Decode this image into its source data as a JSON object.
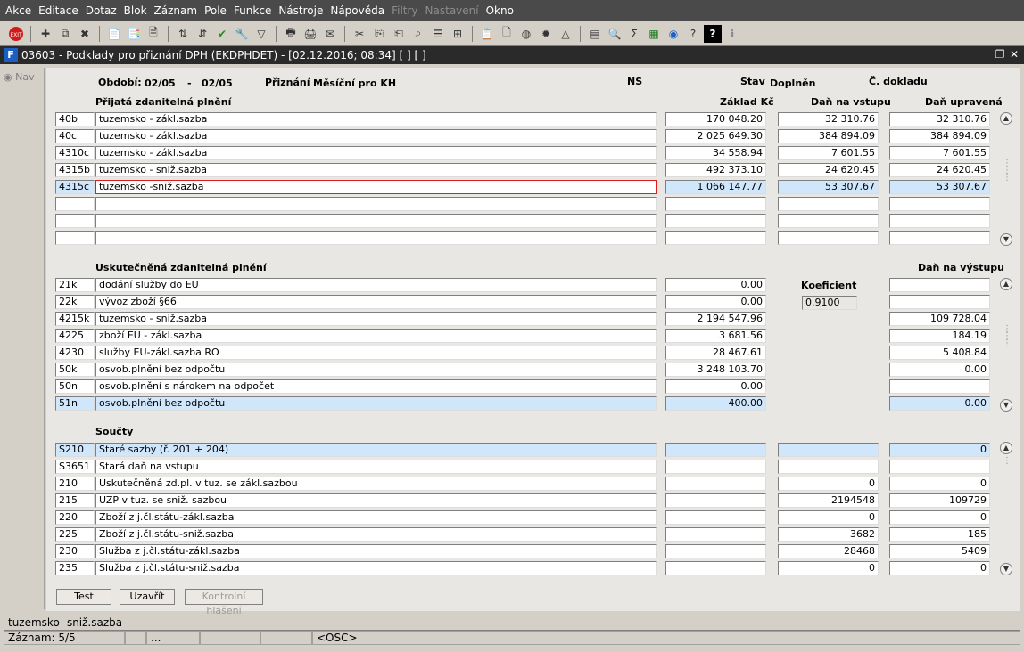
{
  "menu": [
    "Akce",
    "Editace",
    "Dotaz",
    "Blok",
    "Záznam",
    "Pole",
    "Funkce",
    "Nástroje",
    "Nápověda",
    "Filtry",
    "Nastavení",
    "Okno"
  ],
  "menu_disabled": [
    "Filtry",
    "Nastavení"
  ],
  "window_title": "03603 - Podklady pro přiznání DPH (EKDPHDET) - [02.12.2016; 08:34]  [ ]  [ ]",
  "nav_label": "Nav",
  "header": {
    "obdobi_label": "Období:",
    "obdobi_from": "02/05",
    "dash": "-",
    "obdobi_to": "02/05",
    "priznani_label": "Přiznání",
    "priznani_value": "Měsíční pro KH",
    "ns_label": "NS",
    "stav_label": "Stav",
    "stav_value": "Doplněn",
    "cdokladu_label": "Č. dokladu"
  },
  "section1": {
    "title": "Přijatá zdanitelná plnění",
    "col_zaklad": "Základ Kč",
    "col_dan_vstup": "Daň na vstupu",
    "col_dan_upr": "Daň upravená",
    "rows": [
      {
        "code": "40b",
        "desc": "tuzemsko - zákl.sazba",
        "zaklad": "170 048.20",
        "dan": "32 310.76",
        "upr": "32 310.76"
      },
      {
        "code": "40c",
        "desc": "tuzemsko - zákl.sazba",
        "zaklad": "2 025 649.30",
        "dan": "384 894.09",
        "upr": "384 894.09"
      },
      {
        "code": "4310c",
        "desc": "tuzemsko - zákl.sazba",
        "zaklad": "34 558.94",
        "dan": "7 601.55",
        "upr": "7 601.55"
      },
      {
        "code": "4315b",
        "desc": "tuzemsko - sniž.sazba",
        "zaklad": "492 373.10",
        "dan": "24 620.45",
        "upr": "24 620.45"
      },
      {
        "code": "4315c",
        "desc": "tuzemsko -sniž.sazba",
        "zaklad": "1 066 147.77",
        "dan": "53 307.67",
        "upr": "53 307.67"
      },
      {
        "code": "",
        "desc": "",
        "zaklad": "",
        "dan": "",
        "upr": ""
      },
      {
        "code": "",
        "desc": "",
        "zaklad": "",
        "dan": "",
        "upr": ""
      },
      {
        "code": "",
        "desc": "",
        "zaklad": "",
        "dan": "",
        "upr": ""
      }
    ]
  },
  "section2": {
    "title": "Uskutečněná zdanitelná plnění",
    "col_dan_vystup": "Daň na výstupu",
    "koef_label": "Koeficient",
    "koef_value": "0.9100",
    "rows": [
      {
        "code": "21k",
        "desc": "dodání služby do EU",
        "zaklad": "0.00",
        "dan": ""
      },
      {
        "code": "22k",
        "desc": "vývoz zboží §66",
        "zaklad": "0.00",
        "dan": ""
      },
      {
        "code": "4215k",
        "desc": "tuzemsko - sniž.sazba",
        "zaklad": "2 194 547.96",
        "dan": "109 728.04"
      },
      {
        "code": "4225",
        "desc": "zboží EU - zákl.sazba",
        "zaklad": "3 681.56",
        "dan": "184.19"
      },
      {
        "code": "4230",
        "desc": "služby EU-zákl.sazba RO",
        "zaklad": "28 467.61",
        "dan": "5 408.84"
      },
      {
        "code": "50k",
        "desc": "osvob.plnění bez odpočtu",
        "zaklad": "3 248 103.70",
        "dan": "0.00"
      },
      {
        "code": "50n",
        "desc": "osvob.plnění s nárokem na odpočet",
        "zaklad": "0.00",
        "dan": ""
      },
      {
        "code": "51n",
        "desc": "osvob.plnění bez odpočtu",
        "zaklad": "400.00",
        "dan": "0.00"
      }
    ]
  },
  "section3": {
    "title": "Součty",
    "rows": [
      {
        "code": "S210",
        "desc": "Staré sazby (ř. 201 + 204)",
        "a": "",
        "b": "",
        "c": "0"
      },
      {
        "code": "S3651",
        "desc": "Stará daň na vstupu",
        "a": "",
        "b": "",
        "c": ""
      },
      {
        "code": "210",
        "desc": "Uskutečněná zd.pl. v tuz. se zákl.sazbou",
        "a": "",
        "b": "0",
        "c": "0"
      },
      {
        "code": "215",
        "desc": "UZP v tuz. se sniž. sazbou",
        "a": "",
        "b": "2194548",
        "c": "109729"
      },
      {
        "code": "220",
        "desc": "Zboží z j.čl.státu-zákl.sazba",
        "a": "",
        "b": "0",
        "c": "0"
      },
      {
        "code": "225",
        "desc": "Zboží z j.čl.státu-sniž.sazba",
        "a": "",
        "b": "3682",
        "c": "185"
      },
      {
        "code": "230",
        "desc": "Služba z j.čl.státu-zákl.sazba",
        "a": "",
        "b": "28468",
        "c": "5409"
      },
      {
        "code": "235",
        "desc": "Služba z j.čl.státu-sniž.sazba",
        "a": "",
        "b": "0",
        "c": "0"
      }
    ]
  },
  "buttons": {
    "test": "Test",
    "uzavrit": "Uzavřít",
    "kontrolni": "Kontrolní hlášení"
  },
  "status": {
    "field_hint": "tuzemsko -sniž.sazba",
    "record": "Záznam: 5/5",
    "dots": "...",
    "osc": "<OSC>"
  }
}
